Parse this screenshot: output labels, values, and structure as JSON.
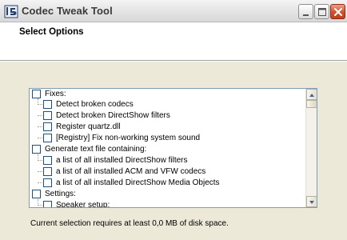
{
  "window": {
    "title": "Codec Tweak Tool"
  },
  "header": {
    "title": "Select Options"
  },
  "tree": {
    "items": [
      {
        "label": "Fixes:",
        "checked": false,
        "level": 0
      },
      {
        "label": "Detect broken codecs",
        "checked": false,
        "level": 1
      },
      {
        "label": "Detect broken DirectShow filters",
        "checked": false,
        "level": 1
      },
      {
        "label": "Register quartz.dll",
        "checked": false,
        "level": 1
      },
      {
        "label": "[Registry] Fix non-working system sound",
        "checked": false,
        "level": 1
      },
      {
        "label": "Generate text file containing:",
        "checked": false,
        "level": 0
      },
      {
        "label": "a list of all installed DirectShow filters",
        "checked": false,
        "level": 1
      },
      {
        "label": "a list of all installed ACM and VFW codecs",
        "checked": false,
        "level": 1
      },
      {
        "label": "a list of all installed DirectShow Media Objects",
        "checked": false,
        "level": 1
      },
      {
        "label": "Settings:",
        "checked": false,
        "level": 0
      },
      {
        "label": "Speaker setup:",
        "checked": false,
        "level": 1
      }
    ]
  },
  "status": {
    "text": "Current selection requires at least 0,0 MB of disk space."
  },
  "icons": {
    "app": "codec-tool-icon",
    "minimize": "minimize-icon",
    "maximize": "maximize-icon",
    "close": "close-icon",
    "scroll_up": "scroll-up-icon",
    "scroll_down": "scroll-down-icon"
  }
}
